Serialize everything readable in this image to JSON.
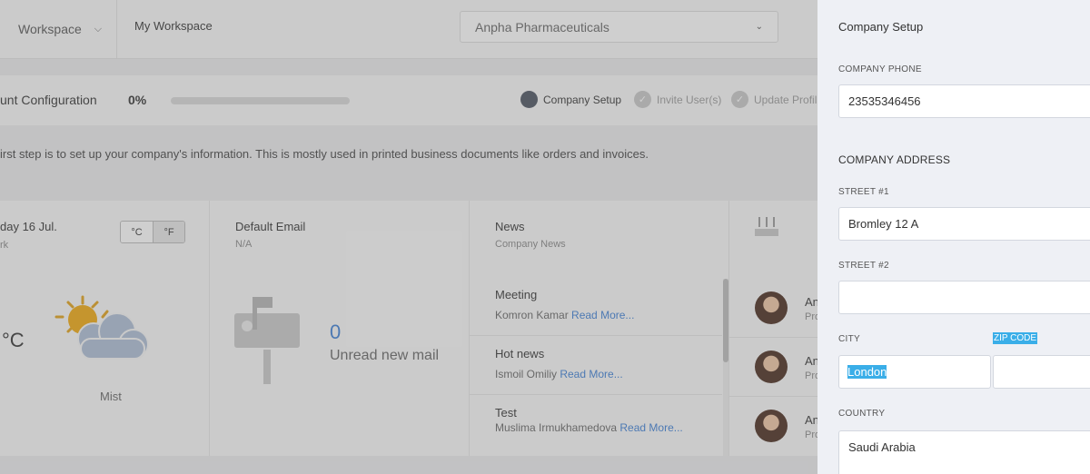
{
  "topbar": {
    "workspace_label": "Workspace",
    "workspace_name": "My Workspace",
    "company_selected": "Anpha Pharmaceuticals"
  },
  "config": {
    "title": "unt Configuration",
    "percent_label": "0%",
    "progress": 0,
    "steps": [
      {
        "label": "Company Setup",
        "state": "active"
      },
      {
        "label": "Invite User(s)",
        "state": "pending"
      },
      {
        "label": "Update Profil",
        "state": "pending"
      }
    ]
  },
  "intro_text": "irst step is to set up your company's information. This is mostly used in printed business documents like orders and invoices.",
  "weather": {
    "date": "day 16 Jul.",
    "location": "rk",
    "unit_c": "°C",
    "unit_f": "°F",
    "temp": "°C",
    "description": "Mist",
    "icon": "partly-cloudy-icon"
  },
  "email": {
    "title": "Default Email",
    "address": "N/A",
    "unread_count": "0",
    "unread_label": "Unread new mail",
    "icon": "mailbox-icon"
  },
  "news": {
    "title": "News",
    "subtitle": "Company News",
    "read_more": "Read More...",
    "items": [
      {
        "headline": "Meeting",
        "author": "Komron Kamar"
      },
      {
        "headline": "Hot news",
        "author": "Ismoil Omiliy"
      },
      {
        "headline": "Test",
        "author": "Muslima Irmukhamedova"
      }
    ]
  },
  "people": {
    "items": [
      {
        "name": "An",
        "role": "Pro"
      },
      {
        "name": "An",
        "role": "Pro"
      },
      {
        "name": "An",
        "role": "Pro"
      }
    ]
  },
  "panel": {
    "title": "Company Setup",
    "phone_label": "COMPANY PHONE",
    "phone_value": "23535346456",
    "address_section": "COMPANY ADDRESS",
    "street1_label": "STREET #1",
    "street1_value": "Bromley 12 A",
    "street2_label": "STREET #2",
    "street2_value": "",
    "city_label": "CITY",
    "city_value": "London",
    "zip_label": "ZIP CODE",
    "zip_value": "",
    "country_label": "COUNTRY",
    "country_value": "Saudi Arabia"
  },
  "colors": {
    "accent": "#3d7fd6",
    "selection": "#3aaee8",
    "panel_bg": "#eef0f5"
  }
}
